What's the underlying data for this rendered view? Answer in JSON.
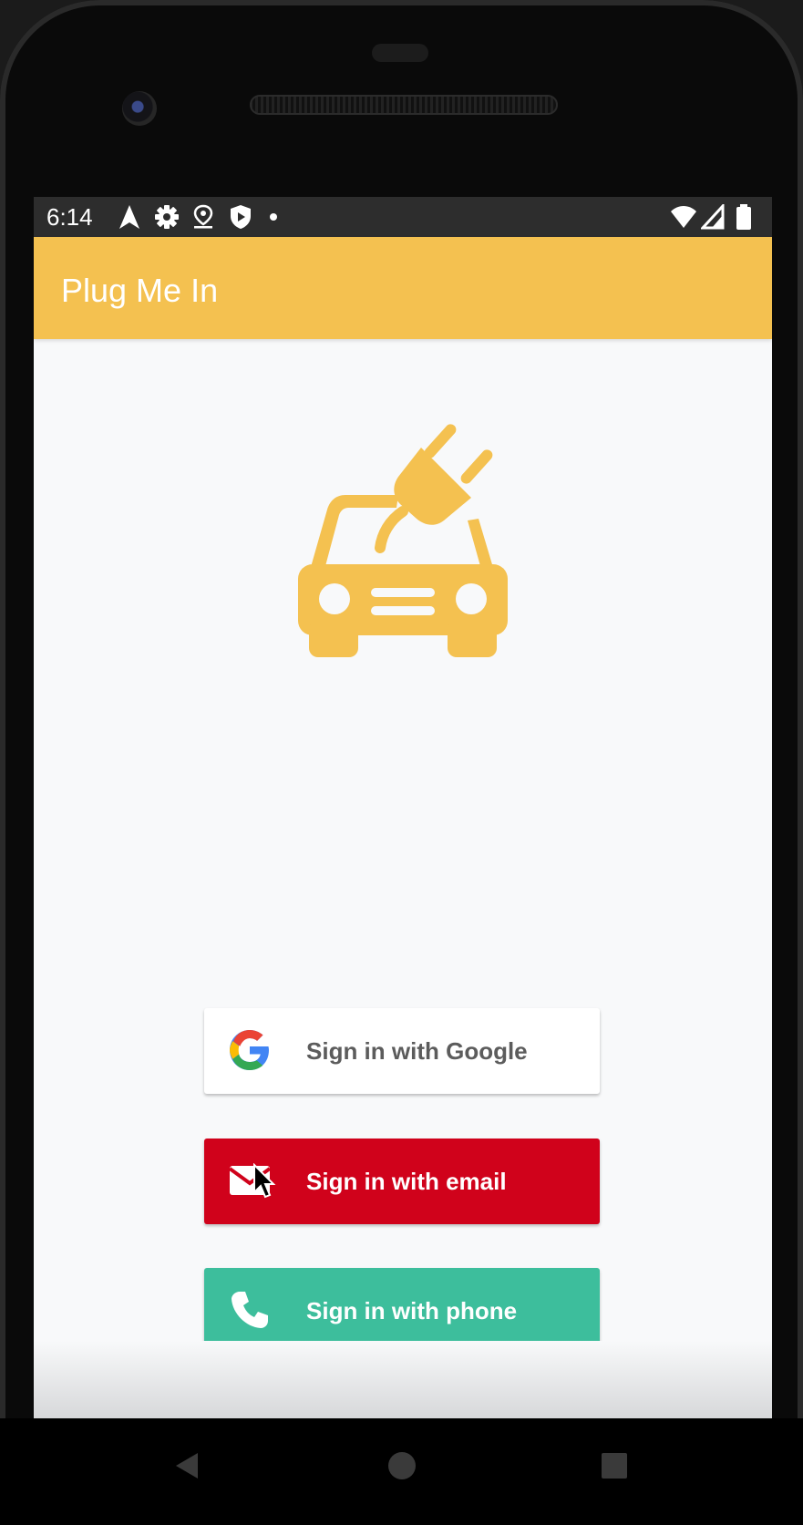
{
  "status_bar": {
    "time": "6:14",
    "left_icons": [
      "navigation-icon",
      "settings-icon",
      "location-icon",
      "shield-icon",
      "notification-dot-icon"
    ],
    "right_icons": [
      "wifi-icon",
      "signal-icon",
      "battery-icon"
    ]
  },
  "app_bar": {
    "title": "Plug Me In"
  },
  "logo": {
    "icon": "electric-car-plug-icon",
    "color": "#f4c150"
  },
  "sign_in_buttons": [
    {
      "label": "Sign in with Google",
      "icon": "google-icon",
      "background": "#ffffff"
    },
    {
      "label": "Sign in with email",
      "icon": "email-icon",
      "background": "#d0021b"
    },
    {
      "label": "Sign in with phone",
      "icon": "phone-icon",
      "background": "#3dbe9c"
    }
  ],
  "nav_bar": {
    "buttons": [
      "back-icon",
      "home-icon",
      "recents-icon"
    ]
  },
  "colors": {
    "accent": "#f4c150",
    "status_bar": "#2d2d2d",
    "screen_bg": "#f8f9fa"
  }
}
